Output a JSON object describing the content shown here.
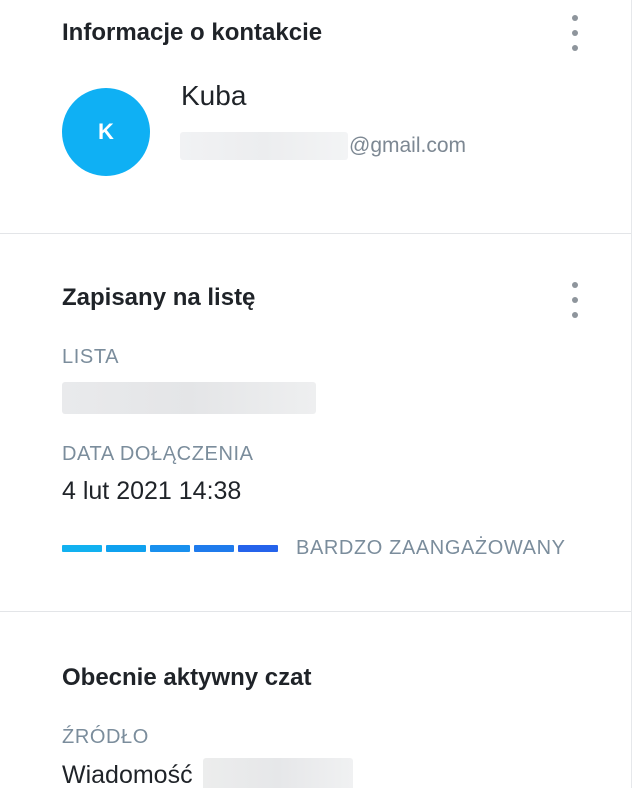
{
  "contact_info": {
    "title": "Informacje o kontakcie",
    "avatar_initial": "K",
    "name": "Kuba",
    "email_domain": "@gmail.com"
  },
  "subscription": {
    "title": "Zapisany na listę",
    "list_label": "LISTA",
    "joined_label": "DATA DOŁĄCZENIA",
    "joined_value": "4 lut 2021 14:38",
    "engagement": {
      "label": "BARDZO ZAANGAŻOWANY",
      "level": 5,
      "max_level": 5,
      "colors": [
        "#12b1f0",
        "#0fa1ef",
        "#1990ee",
        "#1f7bec",
        "#2563eb"
      ]
    }
  },
  "active_chat": {
    "title": "Obecnie aktywny czat",
    "source_label": "ŹRÓDŁO",
    "source_value": "Wiadomość"
  },
  "theme": {
    "avatar_color": "#0fb0f4",
    "label_color": "#7b8d9c"
  }
}
